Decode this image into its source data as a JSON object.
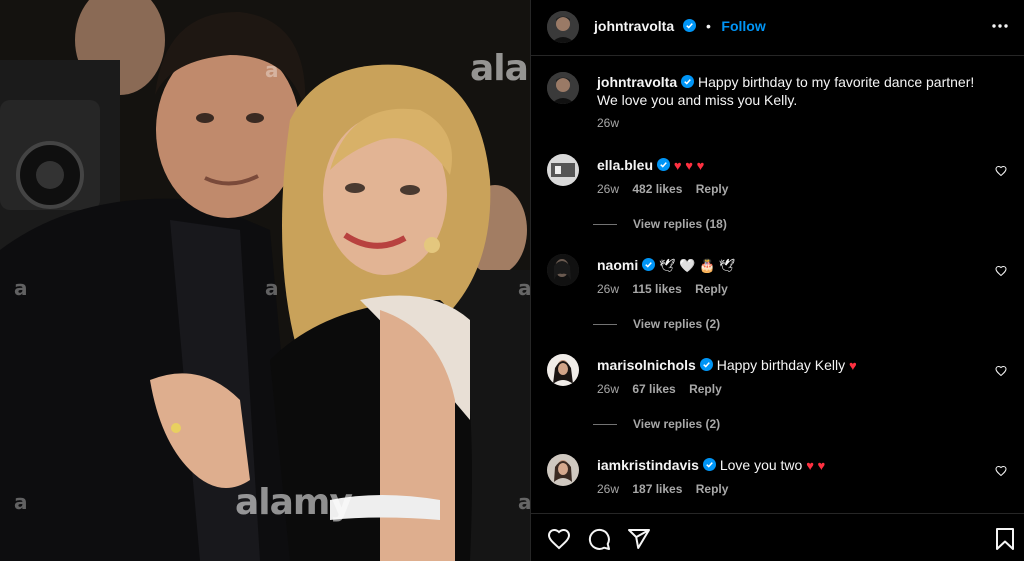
{
  "post": {
    "author": "johntravolta",
    "follow_label": "Follow",
    "separator": "•",
    "caption": "Happy birthday to my favorite dance partner! We love you and miss you Kelly.",
    "caption_time": "26w",
    "photo_watermark_big": "alamy",
    "photo_watermark_small": "a"
  },
  "comments": [
    {
      "user": "ella.bleu",
      "text": "",
      "emoji": "♥ ♥ ♥",
      "time": "26w",
      "likes": "482 likes",
      "reply": "Reply",
      "view_replies": "View replies (18)",
      "verified": true
    },
    {
      "user": "naomi",
      "text": "",
      "emoji": "🕊 🤍 🎂 🕊",
      "time": "26w",
      "likes": "115 likes",
      "reply": "Reply",
      "view_replies": "View replies (2)",
      "verified": true
    },
    {
      "user": "marisolnichols",
      "text": "Happy birthday Kelly",
      "emoji": "♥",
      "time": "26w",
      "likes": "67 likes",
      "reply": "Reply",
      "view_replies": "View replies (2)",
      "verified": true
    },
    {
      "user": "iamkristindavis",
      "text": "Love you two",
      "emoji": "♥ ♥",
      "time": "26w",
      "likes": "187 likes",
      "reply": "Reply",
      "view_replies": "",
      "verified": true
    }
  ],
  "icons": {
    "more": "more-options-icon",
    "like": "heart-icon",
    "comment": "comment-icon",
    "share": "share-icon",
    "save": "bookmark-icon",
    "verified": "verified-badge-icon"
  },
  "colors": {
    "background": "#000000",
    "accent": "#0095f6",
    "verified": "#0095f6",
    "heart": "#ff3040",
    "muted_text": "#a8a8a8"
  }
}
